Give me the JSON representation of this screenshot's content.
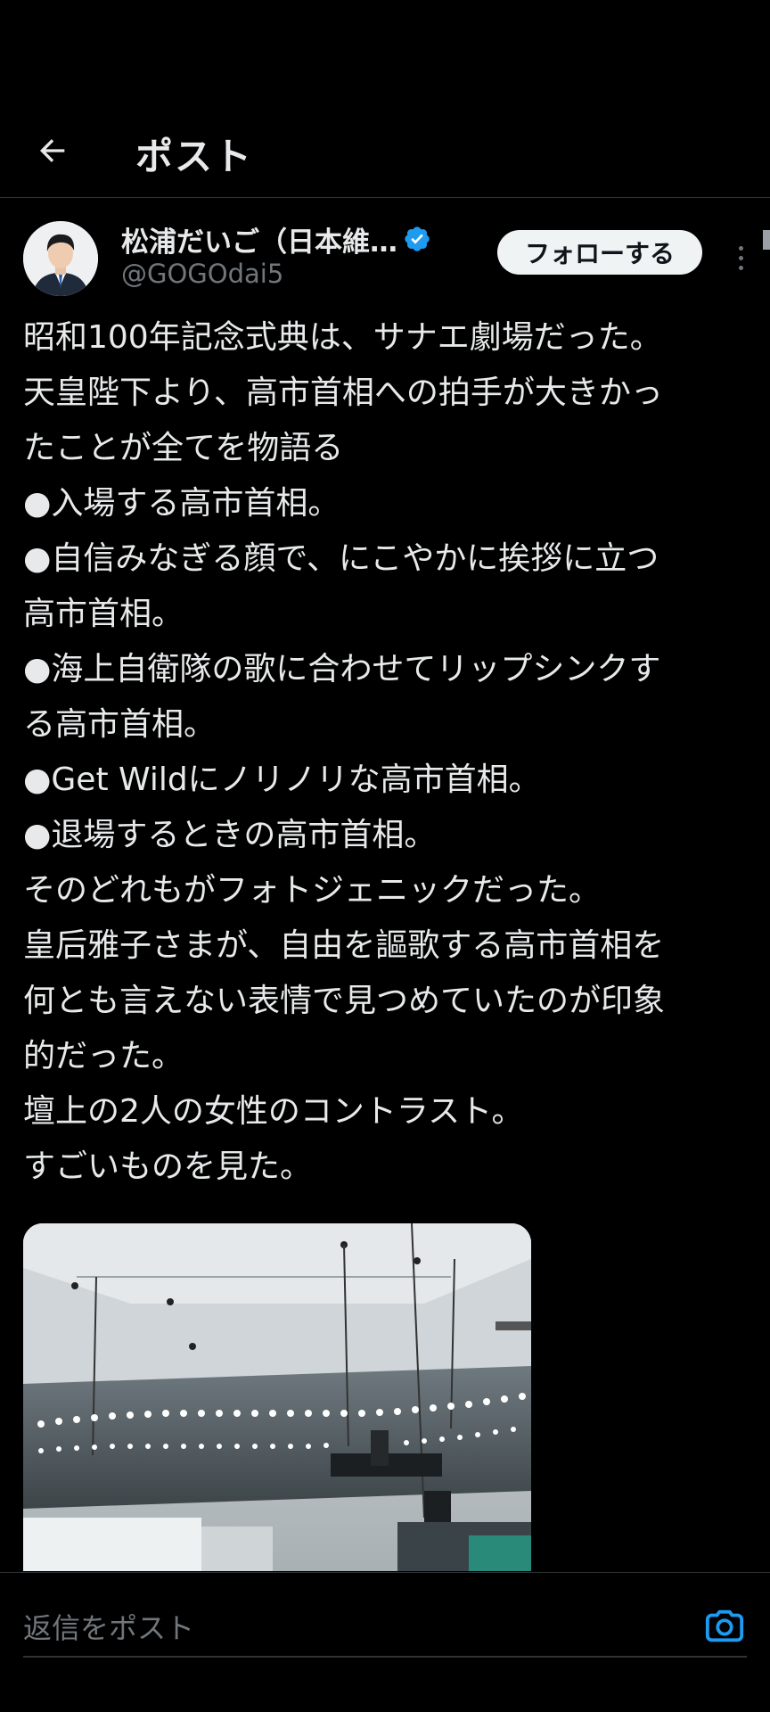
{
  "header": {
    "title": "ポスト",
    "back_icon": "arrow-left-icon"
  },
  "author": {
    "display_name": "松浦だいご（日本維…",
    "handle": "@GOGOdai5",
    "verified": true,
    "verified_color": "#1d9bf0",
    "follow_label": "フォローする"
  },
  "post": {
    "lines": [
      "昭和100年記念式典は、サナエ劇場だった。",
      "天皇陛下より、高市首相への拍手が大きかっ",
      "たことが全てを物語る",
      "●入場する高市首相。",
      "●自信みなぎる顔で、にこやかに挨拶に立つ",
      "高市首相。",
      "●海上自衛隊の歌に合わせてリップシンクす",
      "る高市首相。",
      "●Get Wildにノリノリな高市首相。",
      "●退場するときの高市首相。",
      "そのどれもがフォトジェニックだった。",
      "皇后雅子さまが、自由を謳歌する高市首相を",
      "何とも言えない表情で見つめていたのが印象",
      "的だった。",
      "壇上の2人の女性のコントラスト。",
      "すごいものを見た。"
    ]
  },
  "reply": {
    "placeholder": "返信をポスト",
    "camera_icon": "camera-icon",
    "accent": "#1d9bf0"
  }
}
